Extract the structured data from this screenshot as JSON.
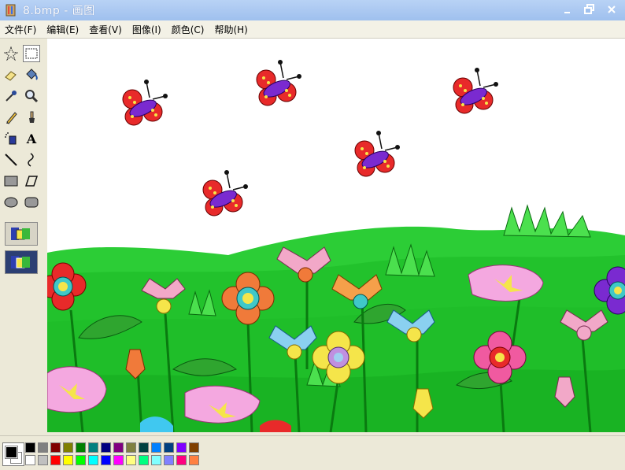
{
  "window": {
    "title": "8.bmp - 画图"
  },
  "menu": [
    "文件(F)",
    "编辑(E)",
    "查看(V)",
    "图像(I)",
    "颜色(C)",
    "帮助(H)"
  ],
  "tools": [
    {
      "name": "free-select-tool",
      "icon": "star-select"
    },
    {
      "name": "rect-select-tool",
      "icon": "dotted-rect",
      "selected": true
    },
    {
      "name": "eraser-tool",
      "icon": "eraser"
    },
    {
      "name": "fill-tool",
      "icon": "paint-bucket"
    },
    {
      "name": "color-picker-tool",
      "icon": "eyedropper"
    },
    {
      "name": "magnifier-tool",
      "icon": "magnifier"
    },
    {
      "name": "pencil-tool",
      "icon": "pencil"
    },
    {
      "name": "brush-tool",
      "icon": "brush"
    },
    {
      "name": "airbrush-tool",
      "icon": "airbrush"
    },
    {
      "name": "text-tool",
      "icon": "letter-a",
      "label": "A"
    },
    {
      "name": "line-tool",
      "icon": "line"
    },
    {
      "name": "curve-tool",
      "icon": "curve"
    },
    {
      "name": "rectangle-tool",
      "icon": "rectangle"
    },
    {
      "name": "polygon-tool",
      "icon": "polygon"
    },
    {
      "name": "ellipse-tool",
      "icon": "ellipse"
    },
    {
      "name": "rounded-rect-tool",
      "icon": "rounded-rectangle"
    }
  ],
  "palette": {
    "foreground": "#000000",
    "background": "#ffffff",
    "top_row": [
      "#000000",
      "#808080",
      "#800000",
      "#808000",
      "#008000",
      "#008080",
      "#000080",
      "#800080",
      "#808040",
      "#004040",
      "#0080ff",
      "#004080",
      "#8000ff",
      "#804000"
    ],
    "bottom_row": [
      "#ffffff",
      "#c0c0c0",
      "#ff0000",
      "#ffff00",
      "#00ff00",
      "#00ffff",
      "#0000ff",
      "#ff00ff",
      "#ffff80",
      "#00ff80",
      "#80ffff",
      "#8080ff",
      "#ff0080",
      "#ff8040"
    ]
  }
}
